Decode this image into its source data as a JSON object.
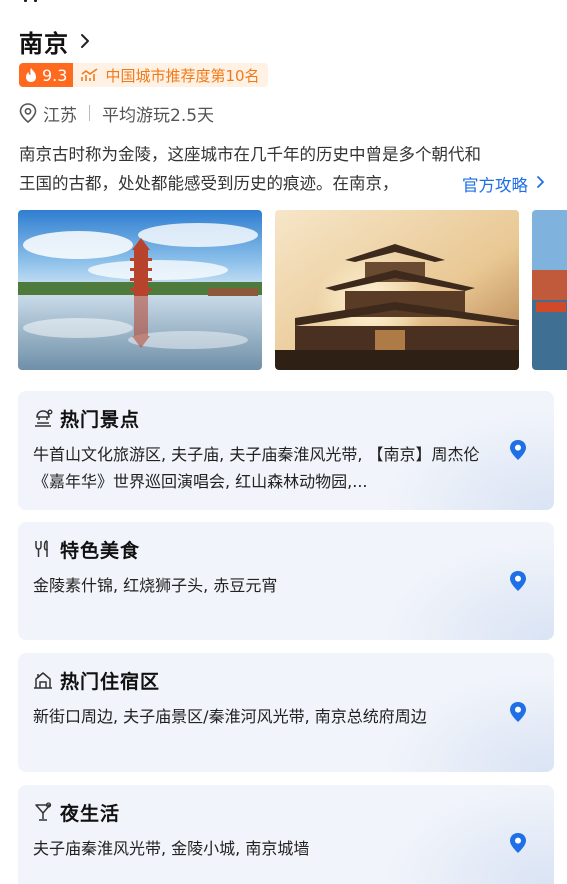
{
  "city": {
    "name": "南京",
    "score": "9.3",
    "rank_text": "中国城市推荐度第10名",
    "province": "江苏",
    "avg_stay": "平均游玩2.5天"
  },
  "description": {
    "line1": "南京古时称为金陵，这座城市在几千年的历史中曾是多个朝代和",
    "line2": "王国的古都，处处都能感受到历史的痕迹。在南京，",
    "guide_link": "官方攻略"
  },
  "gallery": {
    "photos": [
      "pagoda-lake-photo",
      "classical-pavilion-photo",
      "harbor-photo"
    ]
  },
  "cards": [
    {
      "title": "热门景点",
      "icon": "scenic-spot-icon",
      "body": "牛首山文化旅游区, 夫子庙, 夫子庙秦淮风光带, 【南京】周杰伦《嘉年华》世界巡回演唱会, 红山森林动物园,..."
    },
    {
      "title": "特色美食",
      "icon": "food-icon",
      "body": "金陵素什锦, 红烧狮子头, 赤豆元宵"
    },
    {
      "title": "热门住宿区",
      "icon": "hotel-icon",
      "body": "新街口周边, 夫子庙景区/秦淮河风光带, 南京总统府周边"
    },
    {
      "title": "夜生活",
      "icon": "nightlife-icon",
      "body": "夫子庙秦淮风光带, 金陵小城, 南京城墙"
    }
  ],
  "colors": {
    "accent_orange": "#ff6a1f",
    "rank_bg": "#fff1e3",
    "link_blue": "#1f6fe6",
    "card_bg": "#f1f4fa",
    "pin_blue": "#1f6fe6"
  }
}
